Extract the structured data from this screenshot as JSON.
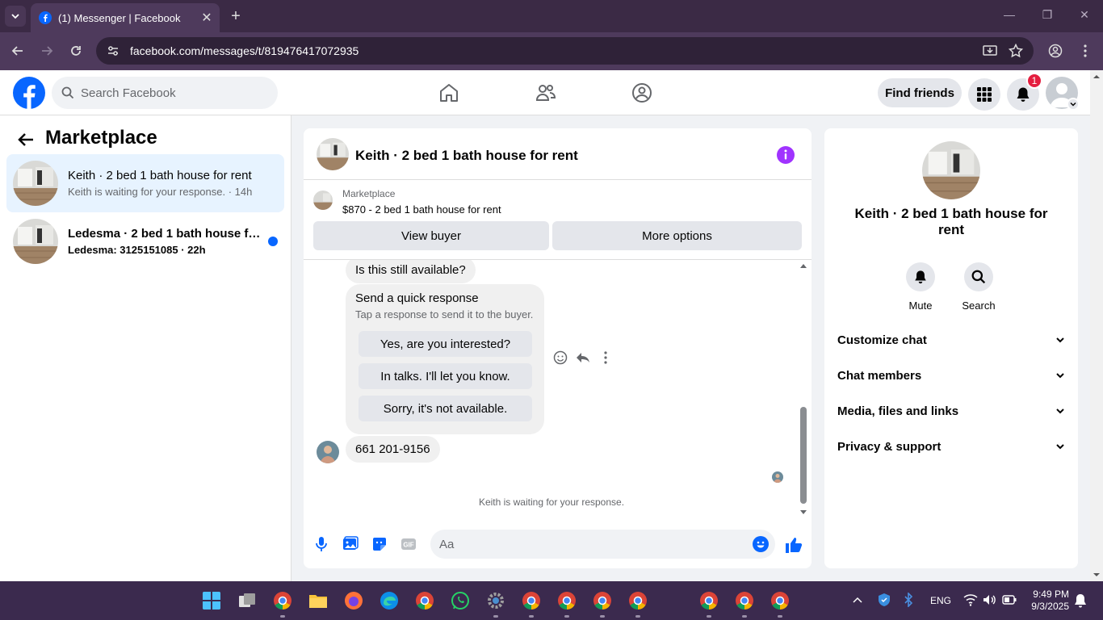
{
  "browser": {
    "tab_title": "(1) Messenger | Facebook",
    "url": "facebook.com/messages/t/819476417072935"
  },
  "header": {
    "search_placeholder": "Search Facebook",
    "find_friends_label": "Find friends",
    "notification_count": "1"
  },
  "sidebar": {
    "title": "Marketplace",
    "conversations": [
      {
        "name": "Keith · 2 bed 1 bath house for rent",
        "preview": "Keith is waiting for your response. · 14h",
        "unread": false
      },
      {
        "name": "Ledesma · 2 bed 1 bath house fo...",
        "preview": "Ledesma: 3125151085 · 22h",
        "unread": true
      }
    ]
  },
  "chat": {
    "title": "Keith · 2 bed 1 bath house for rent",
    "listing": {
      "category": "Marketplace",
      "price_title": "$870 - 2 bed 1 bath house for rent",
      "view_buyer_label": "View buyer",
      "more_options_label": "More options"
    },
    "messages": {
      "first": "Is this still available?",
      "quick_title": "Send a quick response",
      "quick_sub": "Tap a response to send it to the buyer.",
      "quick_options": [
        "Yes, are you interested?",
        "In talks. I'll let you know.",
        "Sorry, it's not available."
      ],
      "phone": "661 201-9156",
      "waiting": "Keith is waiting for your response."
    },
    "composer_placeholder": "Aa"
  },
  "details": {
    "name": "Keith · 2 bed 1 bath house for rent",
    "actions": [
      "Mute",
      "Search"
    ],
    "sections": [
      "Customize chat",
      "Chat members",
      "Media, files and links",
      "Privacy & support"
    ]
  },
  "taskbar": {
    "language": "ENG",
    "time": "9:49 PM",
    "date": "9/3/2025"
  },
  "colors": {
    "accent": "#0866ff",
    "messenger_purple": "#a033ff",
    "badge_red": "#e41e3f"
  }
}
